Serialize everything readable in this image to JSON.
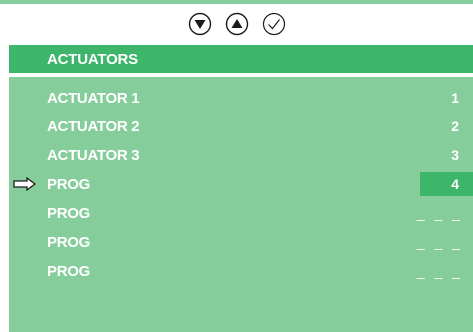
{
  "nav": {
    "down_icon": "triangle-down-circle",
    "up_icon": "triangle-up-circle",
    "confirm_icon": "check-circle"
  },
  "title": "ACTUATORS",
  "rows": [
    {
      "label": "ACTUATOR 1",
      "value": "1"
    },
    {
      "label": "ACTUATOR 2",
      "value": "2"
    },
    {
      "label": "ACTUATOR 3",
      "value": "3"
    },
    {
      "label": "PROG",
      "value": "4",
      "selected": true
    },
    {
      "label": "PROG",
      "value": "_ _ _"
    },
    {
      "label": "PROG",
      "value": "_ _ _"
    },
    {
      "label": "PROG",
      "value": "_ _ _"
    }
  ],
  "colors": {
    "panel": "#86cd9c",
    "header": "#3db56b",
    "text": "#ffffff"
  }
}
